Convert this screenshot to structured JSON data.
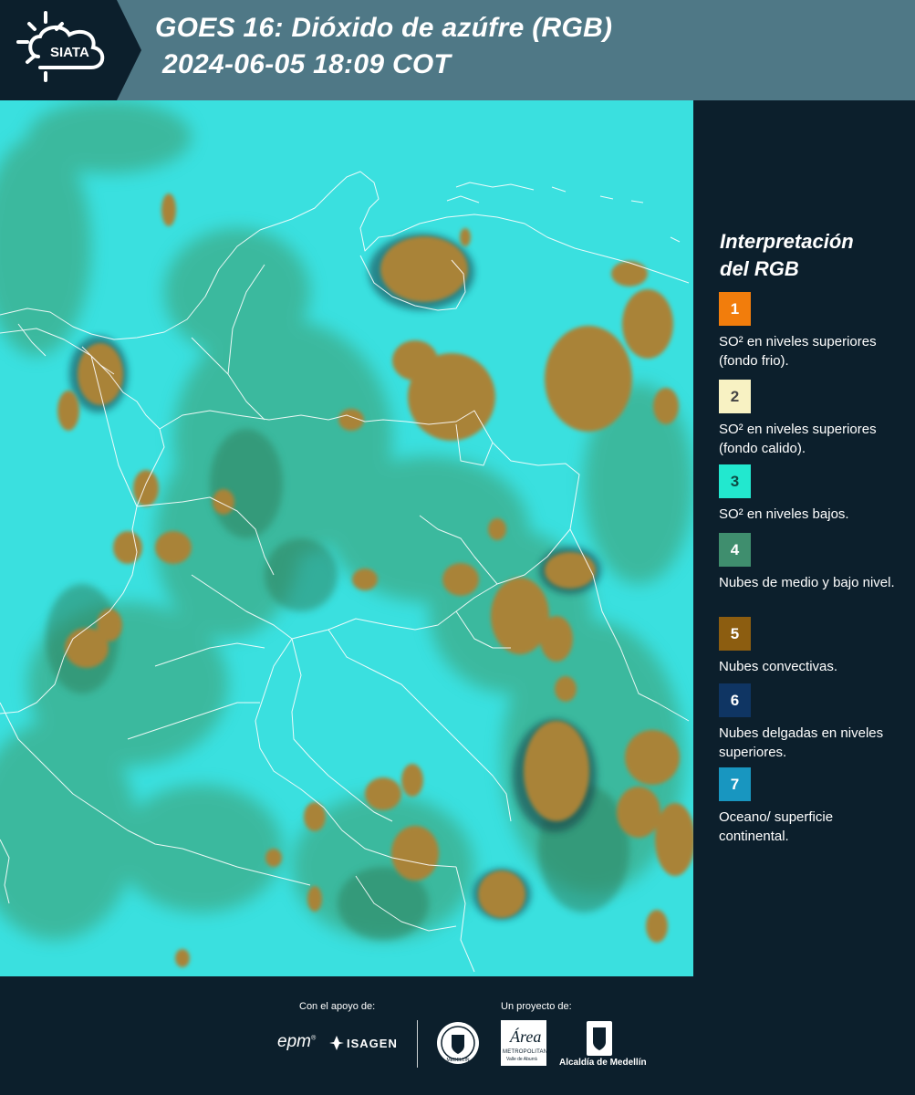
{
  "header": {
    "logo_text": "SIATA",
    "title_line1": "GOES 16: Dióxido de azúfre (RGB)",
    "title_line2": " 2024-06-05 18:09 COT"
  },
  "legend": {
    "title_line1": "Interpretación",
    "title_line2": "del RGB",
    "items": [
      {
        "number": "1",
        "color": "#f27d0c",
        "text": "SO² en niveles superiores (fondo frio)."
      },
      {
        "number": "2",
        "color": "#f8f2c3",
        "text": "SO² en niveles superiores (fondo calido)."
      },
      {
        "number": "3",
        "color": "#22e8cf",
        "text": "SO² en niveles bajos."
      },
      {
        "number": "4",
        "color": "#3f8e6e",
        "text": "Nubes de medio y bajo nivel."
      },
      {
        "number": "5",
        "color": "#8c5d10",
        "text": "Nubes convectivas."
      },
      {
        "number": "6",
        "color": "#0f3563",
        "text": "Nubes delgadas en niveles superiores."
      },
      {
        "number": "7",
        "color": "#1896c0",
        "text": "Oceano/ superficie continental."
      }
    ]
  },
  "footer": {
    "support_label": "Con el apoyo de:",
    "project_label": "Un proyecto de:",
    "epm": "epm",
    "isagen": "ISAGEN",
    "area_name": "Área",
    "area_sub1": "METROPOLITANA",
    "area_sub2": "Valle de Aburrá",
    "alcaldia": "Alcaldía de Medellín",
    "seal_text": "MEDELLÍN"
  },
  "colors": {
    "header_bg": "#4f7886",
    "page_bg": "#0c1f2c",
    "sky_cyan": "#3ae0df",
    "cloud_brown": "#a98338",
    "low_cloud_green": "#3c9a6b"
  }
}
